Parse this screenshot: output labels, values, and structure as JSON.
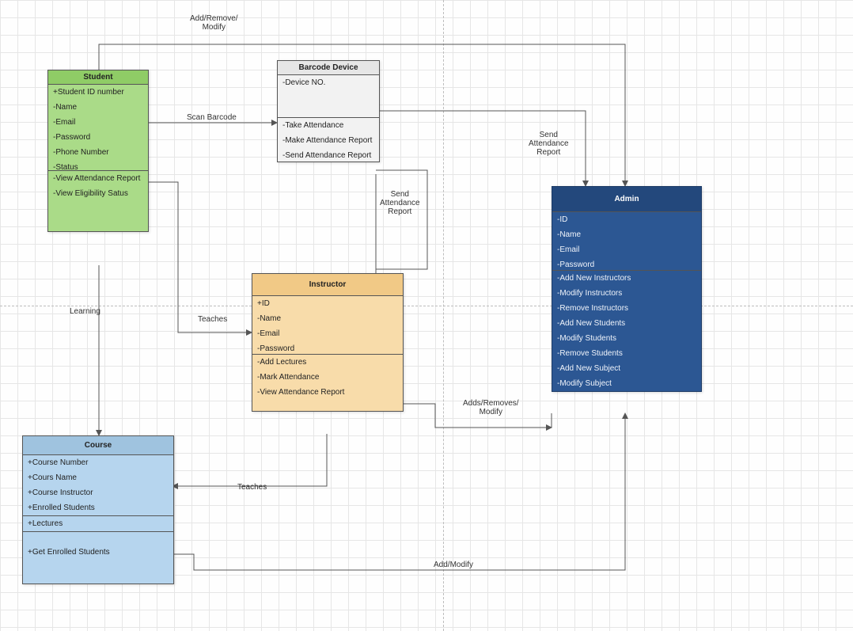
{
  "student": {
    "title": "Student",
    "attrs": [
      "+Student ID number",
      "-Name",
      "-Email",
      "-Password",
      "-Phone Number",
      "-Status"
    ],
    "ops": [
      "-View Attendance Report",
      "-View Eligibility Satus"
    ]
  },
  "course": {
    "title": "Course",
    "attrs": [
      "+Course Number",
      "+Cours Name",
      "+Course Instructor",
      "+Enrolled Students",
      "+Lectures"
    ],
    "ops": [
      "+Get Enrolled Students"
    ]
  },
  "barcode": {
    "title": "Barcode Device",
    "attrs": [
      "-Device NO."
    ],
    "ops": [
      "-Take Attendance",
      "-Make Attendance Report",
      "-Send Attendance Report"
    ]
  },
  "instructor": {
    "title": "Instructor",
    "attrs": [
      "+ID",
      "-Name",
      "-Email",
      "-Password"
    ],
    "ops": [
      "-Add Lectures",
      "-Mark Attendance",
      "-View Attendance Report"
    ]
  },
  "admin": {
    "title": "Admin",
    "attrs": [
      "-ID",
      "-Name",
      "-Email",
      "-Password"
    ],
    "ops": [
      "-Add New Instructors",
      "-Modify Instructors",
      "-Remove Instructors",
      "-Add New Students",
      "-Modify Students",
      "-Remove Students",
      "-Add New Subject",
      "-Modify Subject"
    ]
  },
  "labels": {
    "addRemoveModifyTop": "Add/Remove/\nModify",
    "scanBarcode": "Scan Barcode",
    "sendReport1": "Send\nAttendance\nReport",
    "sendReport2": "Send\nAttendance\nReport",
    "learning": "Learning",
    "teaches1": "Teaches",
    "teaches2": "Teaches",
    "addsRemovesModify": "Adds/Removes/\nModify",
    "addModify": "Add/Modify"
  }
}
